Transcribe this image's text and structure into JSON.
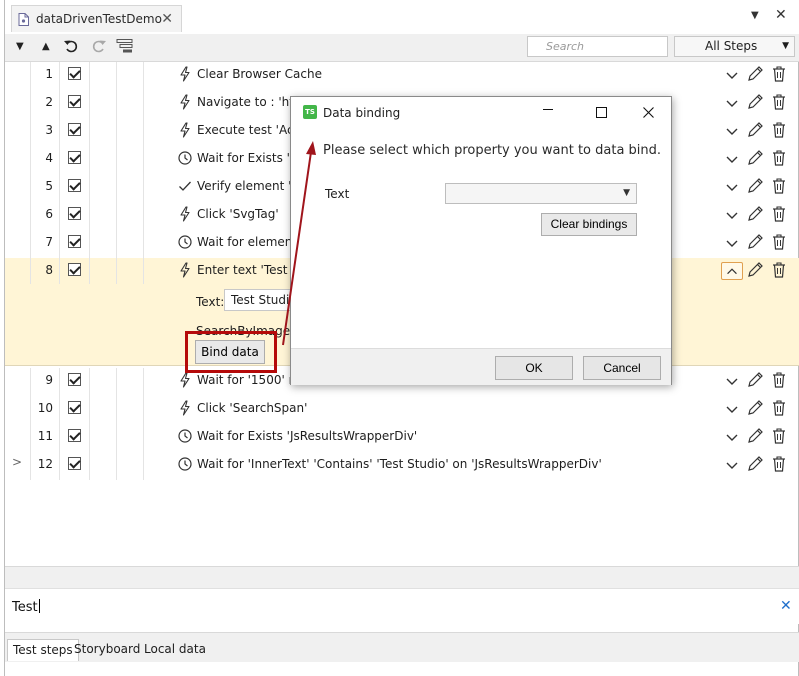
{
  "tab": {
    "title": "dataDrivenTestDemo",
    "close": "✕"
  },
  "window_controls": {
    "menu": "▼",
    "close": "✕"
  },
  "toolbar": {
    "down": "▼",
    "up": "▲",
    "search_placeholder": "Search",
    "filter_value": "All Steps"
  },
  "steps": [
    {
      "num": "1",
      "icon": "bolt-icon",
      "text": "Clear Browser Cache"
    },
    {
      "num": "2",
      "icon": "bolt-icon",
      "text": "Navigate to : 'http"
    },
    {
      "num": "3",
      "icon": "bolt-icon",
      "text": "Execute test 'Acce"
    },
    {
      "num": "4",
      "icon": "clock-icon",
      "text": "Wait for Exists 'Sv"
    },
    {
      "num": "5",
      "icon": "check-icon",
      "text": "Verify element 'Sv"
    },
    {
      "num": "6",
      "icon": "bolt-icon",
      "text": "Click 'SvgTag'"
    },
    {
      "num": "7",
      "icon": "clock-icon",
      "text": "Wait for element"
    },
    {
      "num": "8",
      "icon": "bolt-icon",
      "text": "Enter text 'Test Stu"
    },
    {
      "num": "9",
      "icon": "bolt-icon",
      "text": "Wait for '1500' ms"
    },
    {
      "num": "10",
      "icon": "bolt-icon",
      "text": "Click 'SearchSpan'"
    },
    {
      "num": "11",
      "icon": "clock-icon",
      "text": "Wait for Exists 'JsResultsWrapperDiv'"
    },
    {
      "num": "12",
      "icon": "clock-icon",
      "text": "Wait for 'InnerText' 'Contains' 'Test Studio' on 'JsResultsWrapperDiv'"
    }
  ],
  "expander": ">",
  "detail": {
    "text_label": "Text:",
    "text_value": "Test Studio",
    "search_label": "SearchByImageFi",
    "bind_button": "Bind data"
  },
  "dialog": {
    "title": "Data binding",
    "logo": "TS",
    "prompt": "Please select which property you want to data bind.",
    "property_label": "Text",
    "clear_button": "Clear bindings",
    "ok_button": "OK",
    "cancel_button": "Cancel"
  },
  "quick_input": {
    "value": "Test",
    "clear": "✕"
  },
  "bottom_tabs": [
    "Test steps",
    "Storyboard",
    "Local data"
  ],
  "colors": {
    "selected_row": "#fff5d6",
    "highlight": "#b50a0a",
    "logo": "#43b649",
    "arrow": "#a0151c"
  }
}
